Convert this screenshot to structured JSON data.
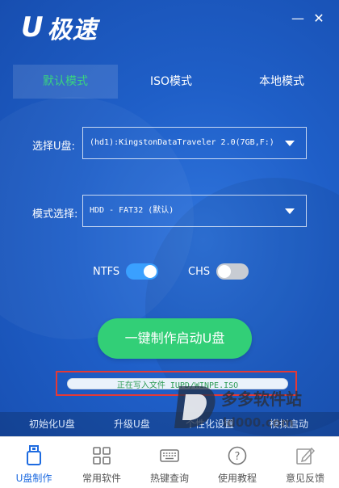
{
  "app": {
    "logo_u": "U",
    "logo_text": "极速",
    "minimize_glyph": "—",
    "close_glyph": "✕"
  },
  "tabs": [
    {
      "label": "默认模式",
      "active": true
    },
    {
      "label": "ISO模式",
      "active": false
    },
    {
      "label": "本地模式",
      "active": false
    }
  ],
  "disk_select": {
    "label": "选择U盘:",
    "value": "(hd1):KingstonDataTraveler 2.0(7GB,F:)"
  },
  "mode_select": {
    "label": "模式选择:",
    "value": "HDD - FAT32 (默认)"
  },
  "toggles": {
    "ntfs": {
      "label": "NTFS",
      "on": true
    },
    "chs": {
      "label": "CHS",
      "on": false
    }
  },
  "main_button": "一键制作启动U盘",
  "progress": {
    "text": "正在写入文件 IUPD/WINPE.ISO"
  },
  "subbar": {
    "items": [
      "初始化U盘",
      "升级U盘",
      "个性化设置",
      "模拟启动"
    ]
  },
  "watermark": {
    "text": "多多软件站",
    "url": "ld000.com"
  },
  "bottom_nav": [
    {
      "label": "U盘制作",
      "icon": "usb-drive-icon",
      "active": true
    },
    {
      "label": "常用软件",
      "icon": "apps-grid-icon",
      "active": false
    },
    {
      "label": "热键查询",
      "icon": "keyboard-icon",
      "active": false
    },
    {
      "label": "使用教程",
      "icon": "help-question-icon",
      "active": false
    },
    {
      "label": "意见反馈",
      "icon": "feedback-edit-icon",
      "active": false
    }
  ],
  "colors": {
    "panel_blue": "#1f5fc8",
    "accent_green": "#32cf77",
    "active_tab_text": "#38d47f",
    "toggle_on": "#3aa0ff",
    "highlight_red": "#e53935",
    "nav_active": "#1e6be0"
  }
}
